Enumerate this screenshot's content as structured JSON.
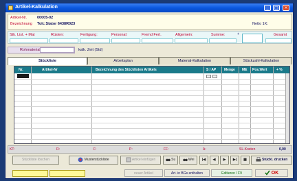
{
  "window": {
    "title": "Artikel-Kalkulation"
  },
  "header": {
    "artikel_label": "Artikel-Nr.",
    "artikel_value": "00005-02",
    "bez_label": "Bezeichnung",
    "bez_value": "Tolc Stator 6438R023",
    "netto_label": "Netto 1K:"
  },
  "categories": [
    "Stk. List. + Mat",
    "Rüsten:",
    "Fertigung:",
    "Personal:",
    "Fremd Fert.",
    "Allgemein:",
    "Summe:",
    "Gesamt"
  ],
  "summe_prefix": "+",
  "rohmaterial": {
    "label": "Rohmaterial",
    "kalk_label": "kalk. Zeit (Std)"
  },
  "tabs": [
    "Stückliste",
    "Arbeitsplan",
    "Material-Kalkulation",
    "Stückzahl-Kalkulation"
  ],
  "grid": {
    "columns": [
      "Nr.",
      "Artikel-Nr",
      "Bezeichnung des Stücklisten Artikels",
      "S / AP",
      "Menge",
      "ME",
      "Pos.Wert",
      "+ %"
    ]
  },
  "footer": {
    "labels": [
      "KT:",
      "R:",
      "F:",
      "P:",
      "FF:",
      "A:",
      "SL-Kosten"
    ],
    "sl_value": "0,00"
  },
  "buttons": {
    "stueckliste_loeschen": "Stückliste löschen",
    "musterstueckliste": "Musterstückliste",
    "artikel_einfuegen": "Artikel einfügen",
    "su": "Su",
    "wei": "Wei",
    "stueckl_drucken": "Stückl. drucken"
  },
  "status": {
    "neuer_artikel": "neuer Artikel",
    "art_in_bgs": "Art. in BGs enthalten",
    "editieren": "Editieren / F9",
    "ok": "OK"
  },
  "colors": {
    "accent_teal": "#1a7a8a",
    "label_red": "#c00030",
    "title_blue": "#0a58e0",
    "ok_red": "#cc0000",
    "edit_green": "#107010"
  }
}
